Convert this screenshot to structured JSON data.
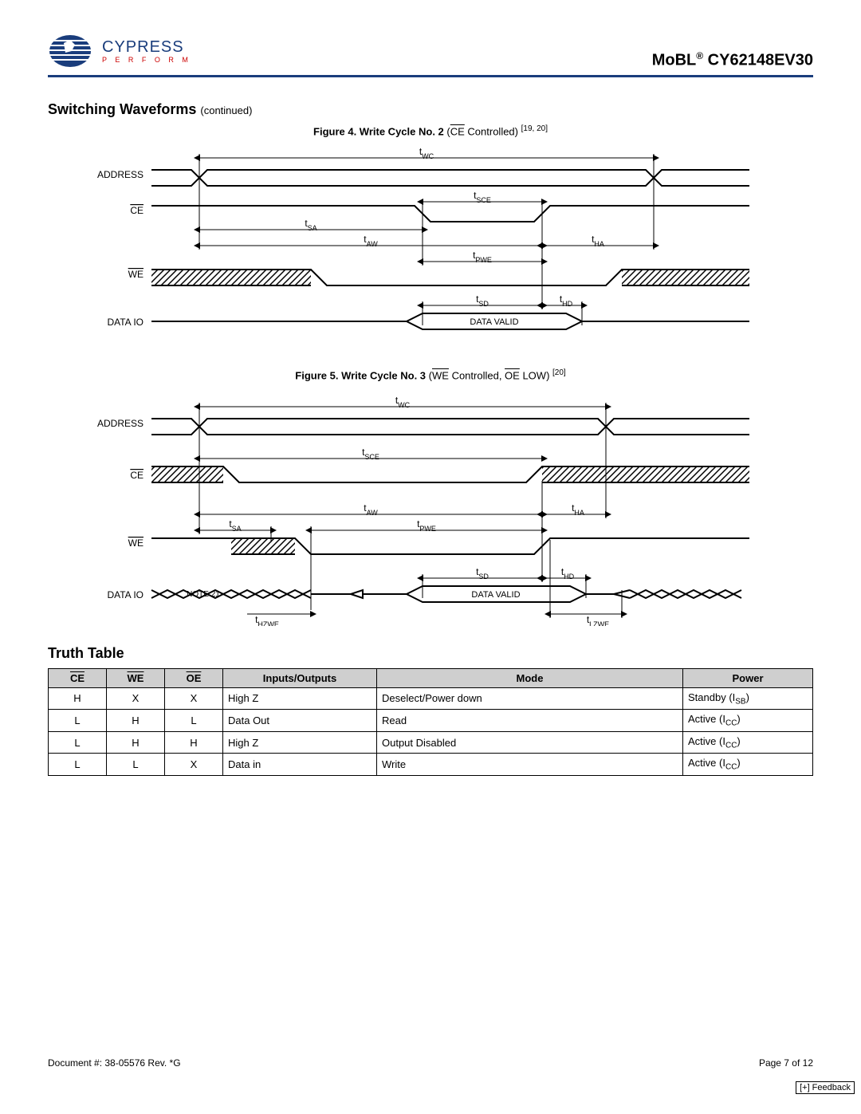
{
  "header": {
    "logo_main": "CYPRESS",
    "logo_sub": "P E R F O R M",
    "part_prefix": "MoBL",
    "part_number": "CY62148EV30"
  },
  "section_title": "Switching Waveforms",
  "continued": "(continued)",
  "figure4": {
    "caption_bold": "Figure 4.  Write Cycle No. 2",
    "caption_rest": " (CE Controlled)",
    "caption_refs": "[19, 20]",
    "labels": {
      "address": "ADDRESS",
      "ce": "CE",
      "we": "WE",
      "dataio": "DATA IO",
      "twc": "tWC",
      "tsce": "tSCE",
      "tsa": "tSA",
      "taw": "tAW",
      "tha": "tHA",
      "tpwe": "tPWE",
      "tsd": "tSD",
      "thd": "tHD",
      "datavalid": "DATA VALID"
    }
  },
  "figure5": {
    "caption_bold": "Figure 5.  Write Cycle No. 3",
    "caption_rest": " (WE Controlled, OE LOW)",
    "caption_refs": "[20]",
    "labels": {
      "address": "ADDRESS",
      "ce": "CE",
      "we": "WE",
      "dataio": "DATA IO",
      "twc": "tWC",
      "tsce": "tSCE",
      "tsa": "tSA",
      "taw": "tAW",
      "tha": "tHA",
      "tpwe": "tPWE",
      "tsd": "tSD",
      "thd": "tHD",
      "thzwe": "tHZWE",
      "tlzwe": "tLZWE",
      "note21": "NOTE 21",
      "datavalid": "DATA VALID"
    }
  },
  "truth_table": {
    "title": "Truth Table",
    "headers": [
      "CE",
      "WE",
      "OE",
      "Inputs/Outputs",
      "Mode",
      "Power"
    ],
    "rows": [
      {
        "ce": "H",
        "we": "X",
        "oe": "X",
        "io": "High Z",
        "mode": "Deselect/Power down",
        "power": "Standby (I",
        "powersub": "SB",
        "powerend": ")"
      },
      {
        "ce": "L",
        "we": "H",
        "oe": "L",
        "io": "Data Out",
        "mode": "Read",
        "power": "Active (I",
        "powersub": "CC",
        "powerend": ")"
      },
      {
        "ce": "L",
        "we": "H",
        "oe": "H",
        "io": "High Z",
        "mode": "Output Disabled",
        "power": "Active (I",
        "powersub": "CC",
        "powerend": ")"
      },
      {
        "ce": "L",
        "we": "L",
        "oe": "X",
        "io": "Data in",
        "mode": "Write",
        "power": "Active (I",
        "powersub": "CC",
        "powerend": ")"
      }
    ]
  },
  "footer": {
    "docnum": "Document #: 38-05576 Rev. *G",
    "page": "Page 7 of 12",
    "feedback": "[+] Feedback"
  }
}
